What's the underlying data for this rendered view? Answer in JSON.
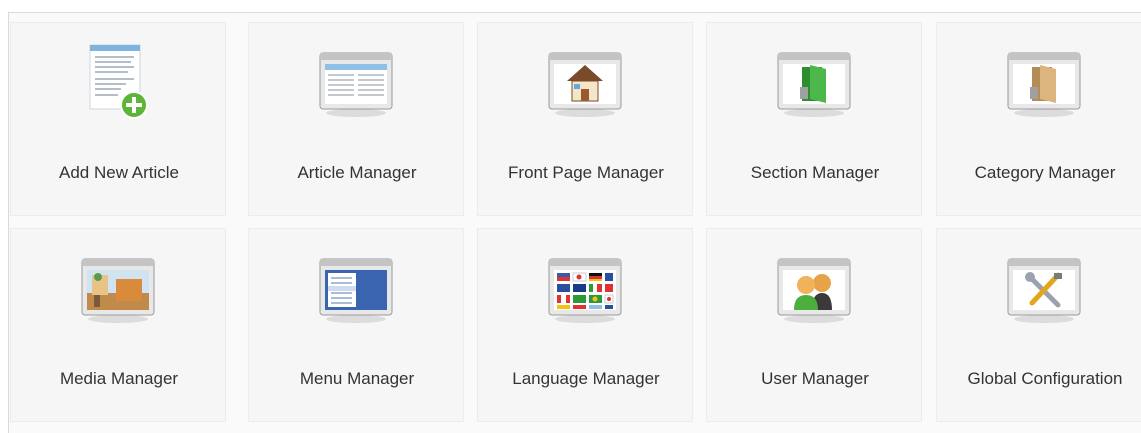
{
  "tiles": [
    {
      "label": "Add New Article",
      "icon": "add-article-icon"
    },
    {
      "label": "Article Manager",
      "icon": "article-manager-icon"
    },
    {
      "label": "Front Page Manager",
      "icon": "house-icon"
    },
    {
      "label": "Section Manager",
      "icon": "green-folder-icon"
    },
    {
      "label": "Category Manager",
      "icon": "tan-folder-icon"
    },
    {
      "label": "Media Manager",
      "icon": "media-image-icon"
    },
    {
      "label": "Menu Manager",
      "icon": "menu-window-icon"
    },
    {
      "label": "Language Manager",
      "icon": "flags-icon"
    },
    {
      "label": "User Manager",
      "icon": "users-icon"
    },
    {
      "label": "Global Configuration",
      "icon": "tools-icon"
    }
  ],
  "colors": {
    "tile_bg": "#f6f6f6",
    "tile_border": "#ececec",
    "label_text": "#333333",
    "add_plus": "#6cc24a",
    "folder_green": "#3aa33a",
    "folder_tan": "#d9b27a",
    "menu_blue": "#3a64b0"
  }
}
